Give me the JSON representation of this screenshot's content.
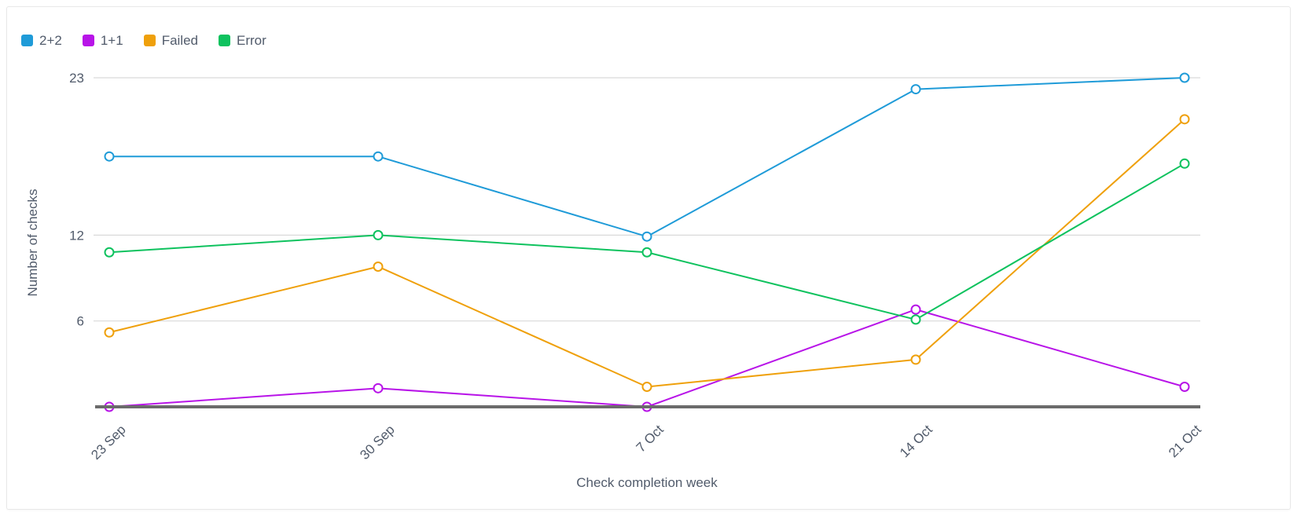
{
  "legend": {
    "position": "top-left",
    "items": [
      {
        "label": "2+2",
        "color": "#1f9bd8"
      },
      {
        "label": "1+1",
        "color": "#b814e8"
      },
      {
        "label": "Failed",
        "color": "#efa00b"
      },
      {
        "label": "Error",
        "color": "#0ec25e"
      }
    ]
  },
  "axes": {
    "y_title": "Number of checks",
    "x_title": "Check completion week",
    "y_ticks": [
      "23",
      "12",
      "6"
    ],
    "x_ticks": [
      "23 Sep",
      "30 Sep",
      "7 Oct",
      "14 Oct",
      "21 Oct"
    ]
  },
  "chart_data": {
    "type": "line",
    "title": "",
    "xlabel": "Check completion week",
    "ylabel": "Number of checks",
    "categories": [
      "23 Sep",
      "30 Sep",
      "7 Oct",
      "14 Oct",
      "21 Oct"
    ],
    "ylim": [
      0,
      23
    ],
    "yticks": [
      6,
      12,
      23
    ],
    "grid": true,
    "legend_position": "top-left",
    "series": [
      {
        "name": "2+2",
        "color": "#1f9bd8",
        "values": [
          17.5,
          17.5,
          11.9,
          22.2,
          23
        ]
      },
      {
        "name": "1+1",
        "color": "#b814e8",
        "values": [
          0,
          1.3,
          0,
          6.8,
          1.4
        ]
      },
      {
        "name": "Failed",
        "color": "#efa00b",
        "values": [
          5.2,
          9.8,
          1.4,
          3.3,
          20.1
        ]
      },
      {
        "name": "Error",
        "color": "#0ec25e",
        "values": [
          10.8,
          12,
          10.8,
          6.1,
          17
        ]
      }
    ]
  }
}
